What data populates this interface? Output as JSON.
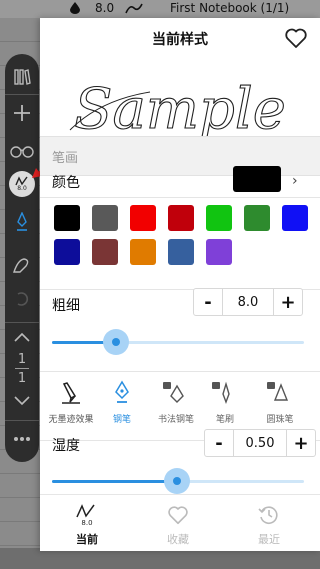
{
  "background": {
    "notebook_title": "First Notebook (1/1)",
    "pen_value": "8.0",
    "page_current": "1",
    "page_total": "1"
  },
  "toolbar": {
    "active_pen_size": "8.0"
  },
  "panel": {
    "title": "当前样式",
    "sample_text": "Sample",
    "section_label": "笔画",
    "color_label": "颜色",
    "current_color": "#000000",
    "palette": [
      "#000000",
      "#595959",
      "#f20000",
      "#c0000b",
      "#11c411",
      "#2e8b2e",
      "#1010f5",
      "#0d0d9a",
      "#7a3535",
      "#e07b00",
      "#36609e",
      "#7f40d8"
    ],
    "width_label": "粗细",
    "width_value": "8.0",
    "width_level": 0.23,
    "minus": "-",
    "plus": "+",
    "pens": [
      {
        "name": "无墨迹效果",
        "icon": "pen-nib-slanted-icon",
        "state": "normal"
      },
      {
        "name": "钢笔",
        "icon": "fountain-pen-icon",
        "state": "active"
      },
      {
        "name": "书法钢笔",
        "icon": "calligraphy-pen-icon",
        "state": "locked"
      },
      {
        "name": "笔刷",
        "icon": "brush-icon",
        "state": "locked"
      },
      {
        "name": "圆珠笔",
        "icon": "ballpoint-pen-icon",
        "state": "locked"
      }
    ],
    "humidity_label": "湿度",
    "humidity_value": "0.50",
    "humidity_level": 0.5,
    "tabs": [
      {
        "label": "当前",
        "icon": "pen-size-icon",
        "sub": "8.0",
        "active": true
      },
      {
        "label": "收藏",
        "icon": "heart-icon",
        "active": false
      },
      {
        "label": "最近",
        "icon": "history-icon",
        "active": false
      }
    ]
  }
}
